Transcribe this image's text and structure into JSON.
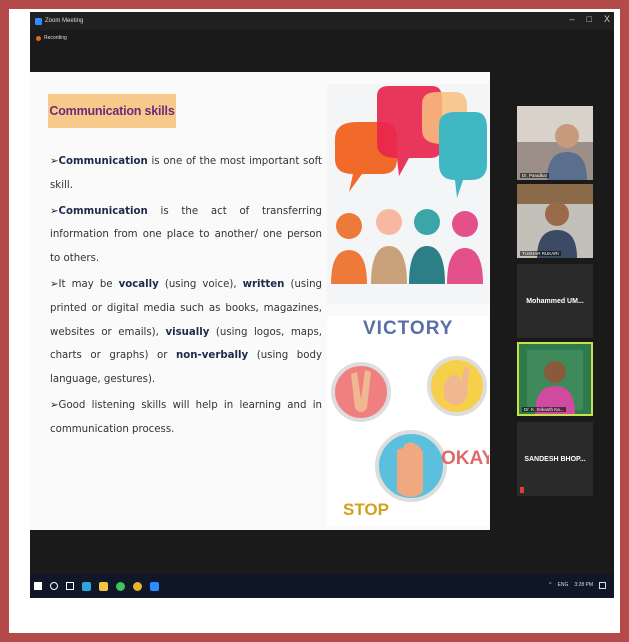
{
  "window": {
    "title": "Zoom Meeting",
    "minimize": "–",
    "maximize": "□",
    "close": "X"
  },
  "recording": {
    "label": "Recording"
  },
  "slide": {
    "title": "Communication skills",
    "bullets": [
      {
        "bold": "Communication",
        "rest": " is one of the most important soft skill."
      },
      {
        "bold": "Communication",
        "rest": " is the act of transferring information from one place to another/ one person to others."
      }
    ],
    "b3": {
      "p1": "It may be ",
      "vocally": "vocally",
      "p2": " (using voice), ",
      "written": "written",
      "p3": " (using printed or digital media such as books, magazines, websites or emails), ",
      "visually": "visually",
      "p4": " (using logos, maps, charts or graphs) or ",
      "nonverbally": "non-verbally",
      "p5": " (using body language, gestures)."
    },
    "b4": "Good listening skills will help in learning and in communication process.",
    "gesture_words": {
      "victory": "VICTORY",
      "okay": "OKAY",
      "stop": "STOP"
    }
  },
  "participants": [
    {
      "name": "Dr. Paradkar",
      "video": true
    },
    {
      "name": "TUSHAR RUKARI",
      "video": true
    },
    {
      "name": "Mohammed UM...",
      "video": false
    },
    {
      "name": "Dr. K. Srikanth Ka...",
      "video": true,
      "active": true
    },
    {
      "name": "SANDESH BHOP...",
      "video": false
    }
  ],
  "taskbar": {
    "language": "ENG",
    "time": "3:28 PM"
  },
  "colors": {
    "frame": "#b44a4a",
    "title_bg": "#f8c98a",
    "title_text": "#6b2a7a",
    "active_speaker": "#c9e04a"
  }
}
